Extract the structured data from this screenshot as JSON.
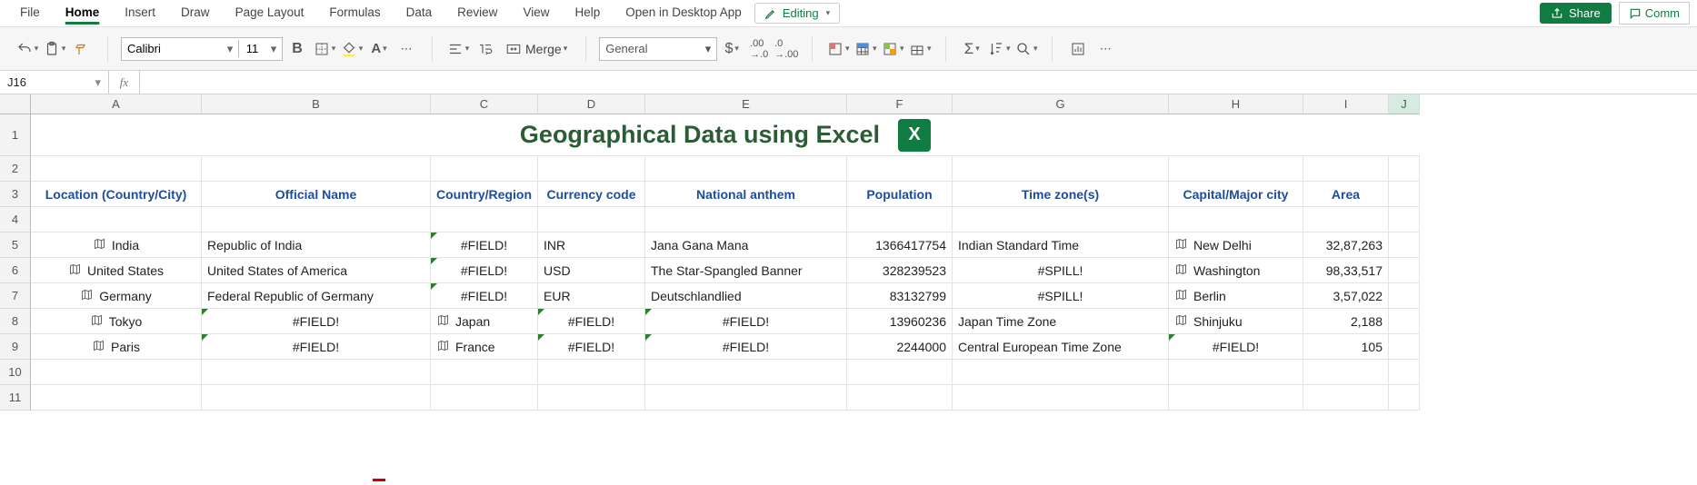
{
  "ribbon": {
    "tabs": [
      "File",
      "Home",
      "Insert",
      "Draw",
      "Page Layout",
      "Formulas",
      "Data",
      "Review",
      "View",
      "Help",
      "Open in Desktop App"
    ],
    "active": "Home",
    "editing_label": "Editing",
    "share_label": "Share",
    "comments_label": "Comm"
  },
  "toolbar": {
    "font_name": "Calibri",
    "font_size": "11",
    "merge_label": "Merge",
    "number_format": "General"
  },
  "fbar": {
    "name_box": "J16",
    "fx": "fx",
    "formula": ""
  },
  "columns": [
    "A",
    "B",
    "C",
    "D",
    "E",
    "F",
    "G",
    "H",
    "I",
    "J"
  ],
  "rows": [
    "1",
    "2",
    "3",
    "4",
    "5",
    "6",
    "7",
    "8",
    "9",
    "10",
    "11"
  ],
  "title": "Geographical Data using Excel",
  "headers": {
    "A": "Location (Country/City)",
    "B": "Official Name",
    "C": "Country/Region",
    "D": "Currency code",
    "E": "National anthem",
    "F": "Population",
    "G": "Time zone(s)",
    "H": "Capital/Major city",
    "I": "Area"
  },
  "data": [
    {
      "loc": "India",
      "official": "Republic of India",
      "region": "#FIELD!",
      "curr": "INR",
      "anthem": "Jana Gana Mana",
      "pop": "1366417754",
      "tz": "Indian Standard Time",
      "capital": "New Delhi",
      "area": "32,87,263",
      "region_err": true,
      "tz_center": false,
      "cap_icon": true
    },
    {
      "loc": "United States",
      "official": "United States of America",
      "region": "#FIELD!",
      "curr": "USD",
      "anthem": "The Star-Spangled Banner",
      "pop": "328239523",
      "tz": "#SPILL!",
      "capital": "Washington",
      "area": "98,33,517",
      "region_err": true,
      "tz_center": true,
      "cap_icon": true
    },
    {
      "loc": "Germany",
      "official": "Federal Republic of Germany",
      "region": "#FIELD!",
      "curr": "EUR",
      "anthem": "Deutschlandlied",
      "pop": "83132799",
      "tz": "#SPILL!",
      "capital": "Berlin",
      "area": "3,57,022",
      "region_err": true,
      "tz_center": true,
      "cap_icon": true
    },
    {
      "loc": "Tokyo",
      "official": "#FIELD!",
      "region": "Japan",
      "curr": "#FIELD!",
      "anthem": "#FIELD!",
      "pop": "13960236",
      "tz": "Japan Time Zone",
      "capital": "Shinjuku",
      "area": "2,188",
      "official_err": true,
      "official_center": true,
      "curr_center": true,
      "curr_err": true,
      "anthem_center": true,
      "anthem_err": true,
      "region_icon": true,
      "cap_icon": true
    },
    {
      "loc": "Paris",
      "official": "#FIELD!",
      "region": "France",
      "curr": "#FIELD!",
      "anthem": "#FIELD!",
      "pop": "2244000",
      "tz": "Central European Time Zone",
      "capital": "#FIELD!",
      "area": "105",
      "official_err": true,
      "official_center": true,
      "curr_center": true,
      "curr_err": true,
      "anthem_center": true,
      "anthem_err": true,
      "region_icon": true,
      "cap_center": true,
      "cap_err": true
    }
  ]
}
